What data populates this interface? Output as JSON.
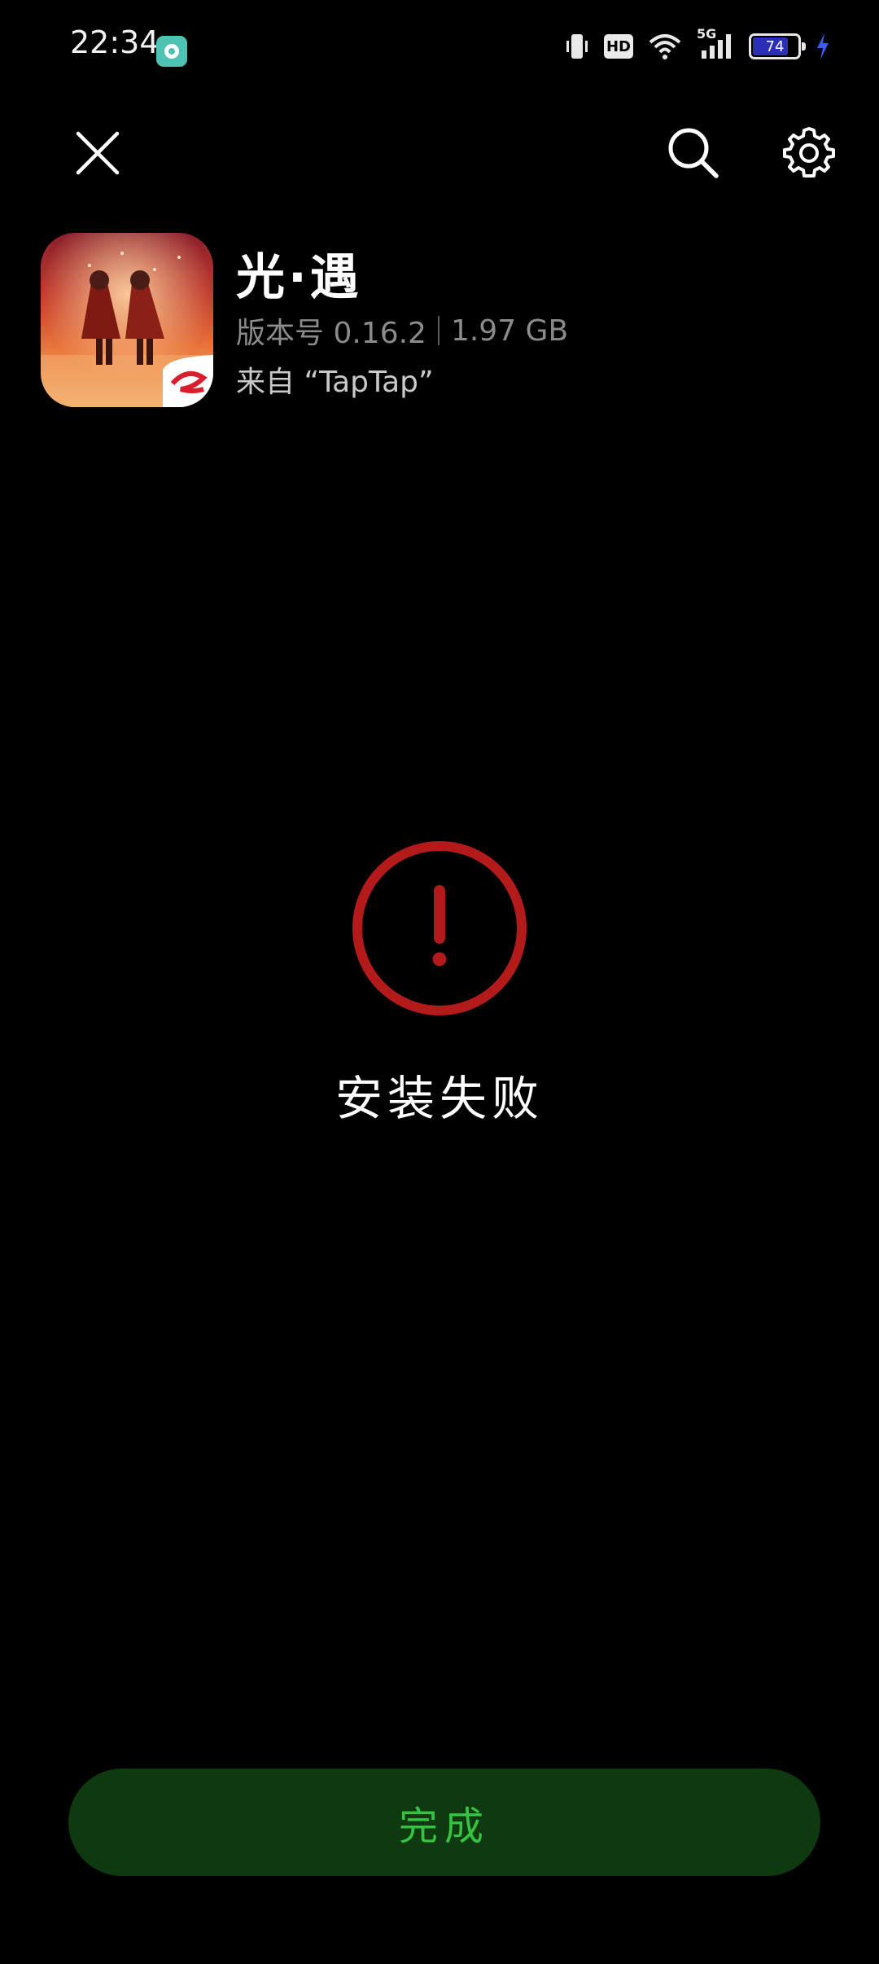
{
  "status_bar": {
    "time": "22:34",
    "network": "5G",
    "hd_label": "HD",
    "battery_level": "74",
    "battery_fill_fraction": 0.74,
    "charging_color": "#3b5bff"
  },
  "top_bar": {
    "close_icon": "close-icon",
    "search_icon": "search-icon",
    "settings_icon": "gear-icon"
  },
  "app": {
    "name": "光·遇",
    "version_label": "版本号 0.16.2",
    "size": "1.97 GB",
    "source": "来自 “TapTap”"
  },
  "result": {
    "icon": "error-circle-icon",
    "icon_color": "#b31b1b",
    "title": "安装失败"
  },
  "actions": {
    "done_label": "完成",
    "done_bg": "#0f3a10",
    "done_text_color": "#36c243"
  }
}
